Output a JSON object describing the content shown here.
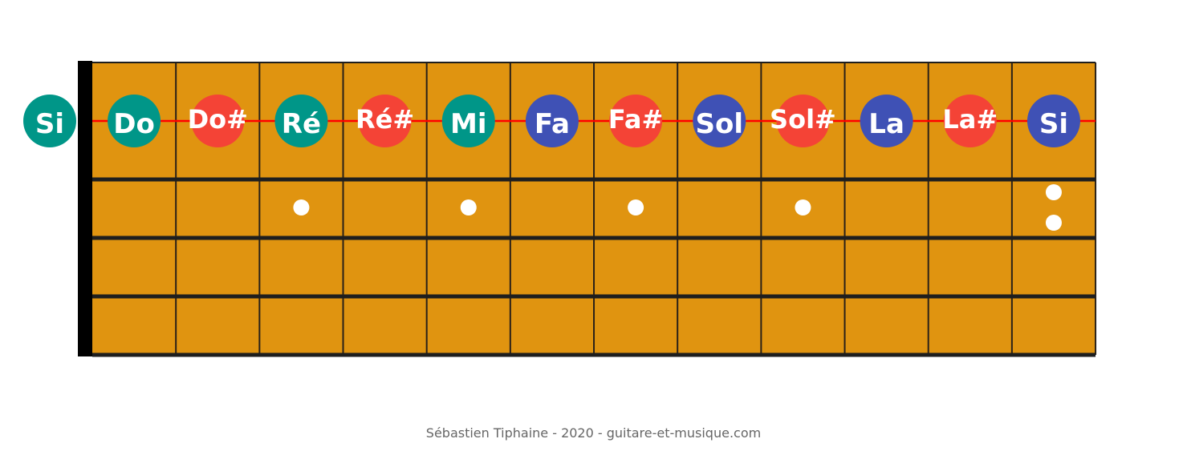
{
  "open_note": {
    "label": "Si",
    "kind": "natural"
  },
  "notes": [
    {
      "label": "Do",
      "kind": "natural"
    },
    {
      "label": "Do#",
      "kind": "sharp"
    },
    {
      "label": "Ré",
      "kind": "natural"
    },
    {
      "label": "Ré#",
      "kind": "sharp"
    },
    {
      "label": "Mi",
      "kind": "natural"
    },
    {
      "label": "Fa",
      "kind": "blue"
    },
    {
      "label": "Fa#",
      "kind": "sharp"
    },
    {
      "label": "Sol",
      "kind": "blue"
    },
    {
      "label": "Sol#",
      "kind": "sharp"
    },
    {
      "label": "La",
      "kind": "blue"
    },
    {
      "label": "La#",
      "kind": "sharp"
    },
    {
      "label": "Si",
      "kind": "blue"
    }
  ],
  "fret_count": 12,
  "string_count": 4,
  "highlighted_string": 1,
  "single_inlay_frets": [
    3,
    5,
    7,
    9
  ],
  "double_inlay_frets": [
    12
  ],
  "colors": {
    "board": "#e09410",
    "nut": "#000000",
    "fret_line": "#2a2118",
    "string_line": "#1e1e1e",
    "highlight_string": "#ff0000",
    "natural": "#009688",
    "sharp": "#f44336",
    "blue": "#3f51b5",
    "inlay": "#ffffff"
  },
  "credit": "Sébastien Tiphaine - 2020 - guitare-et-musique.com"
}
